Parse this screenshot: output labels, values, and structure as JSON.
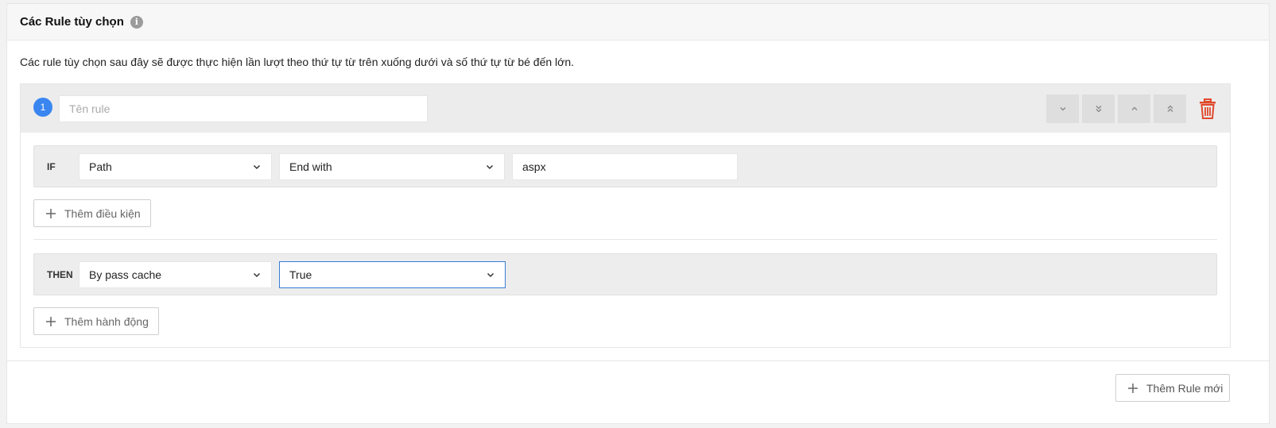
{
  "header": {
    "title": "Các Rule tùy chọn",
    "info_icon": "i"
  },
  "description": "Các rule tùy chọn sau đây sẽ được thực hiện lần lượt theo thứ tự từ trên xuống dưới và số thứ tự từ bé đến lớn.",
  "rule": {
    "number": "1",
    "name_value": "",
    "name_placeholder": "Tên rule",
    "move_buttons": [
      "move-down",
      "move-to-bottom",
      "move-up",
      "move-to-top"
    ],
    "delete_icon_color": "#e0492b",
    "condition": {
      "label": "IF",
      "field": "Path",
      "operator": "End with",
      "value": "aspx"
    },
    "add_condition_label": "Thêm điều kiện",
    "action": {
      "label": "THEN",
      "type": "By pass cache",
      "value": "True"
    },
    "add_action_label": "Thêm hành động"
  },
  "add_rule_label": "Thêm Rule mới",
  "colors": {
    "accent": "#3a86f0",
    "danger": "#e0492b",
    "focus_border": "#3a7bd5"
  }
}
